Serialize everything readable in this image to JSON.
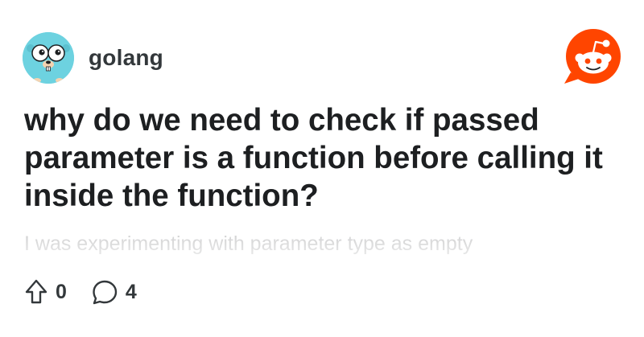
{
  "subreddit": {
    "name": "golang",
    "avatar_icon": "gopher-icon",
    "avatar_color": "#6dd2e0"
  },
  "brand": {
    "icon": "reddit-logo-icon",
    "color": "#ff4500"
  },
  "post": {
    "title": "why do we need to check if passed parameter is a function before calling it inside the function?",
    "excerpt": "I was experimenting with parameter type as empty"
  },
  "stats": {
    "upvotes": "0",
    "upvote_icon": "upvote-arrow-icon",
    "comments": "4",
    "comment_icon": "comment-bubble-icon"
  }
}
